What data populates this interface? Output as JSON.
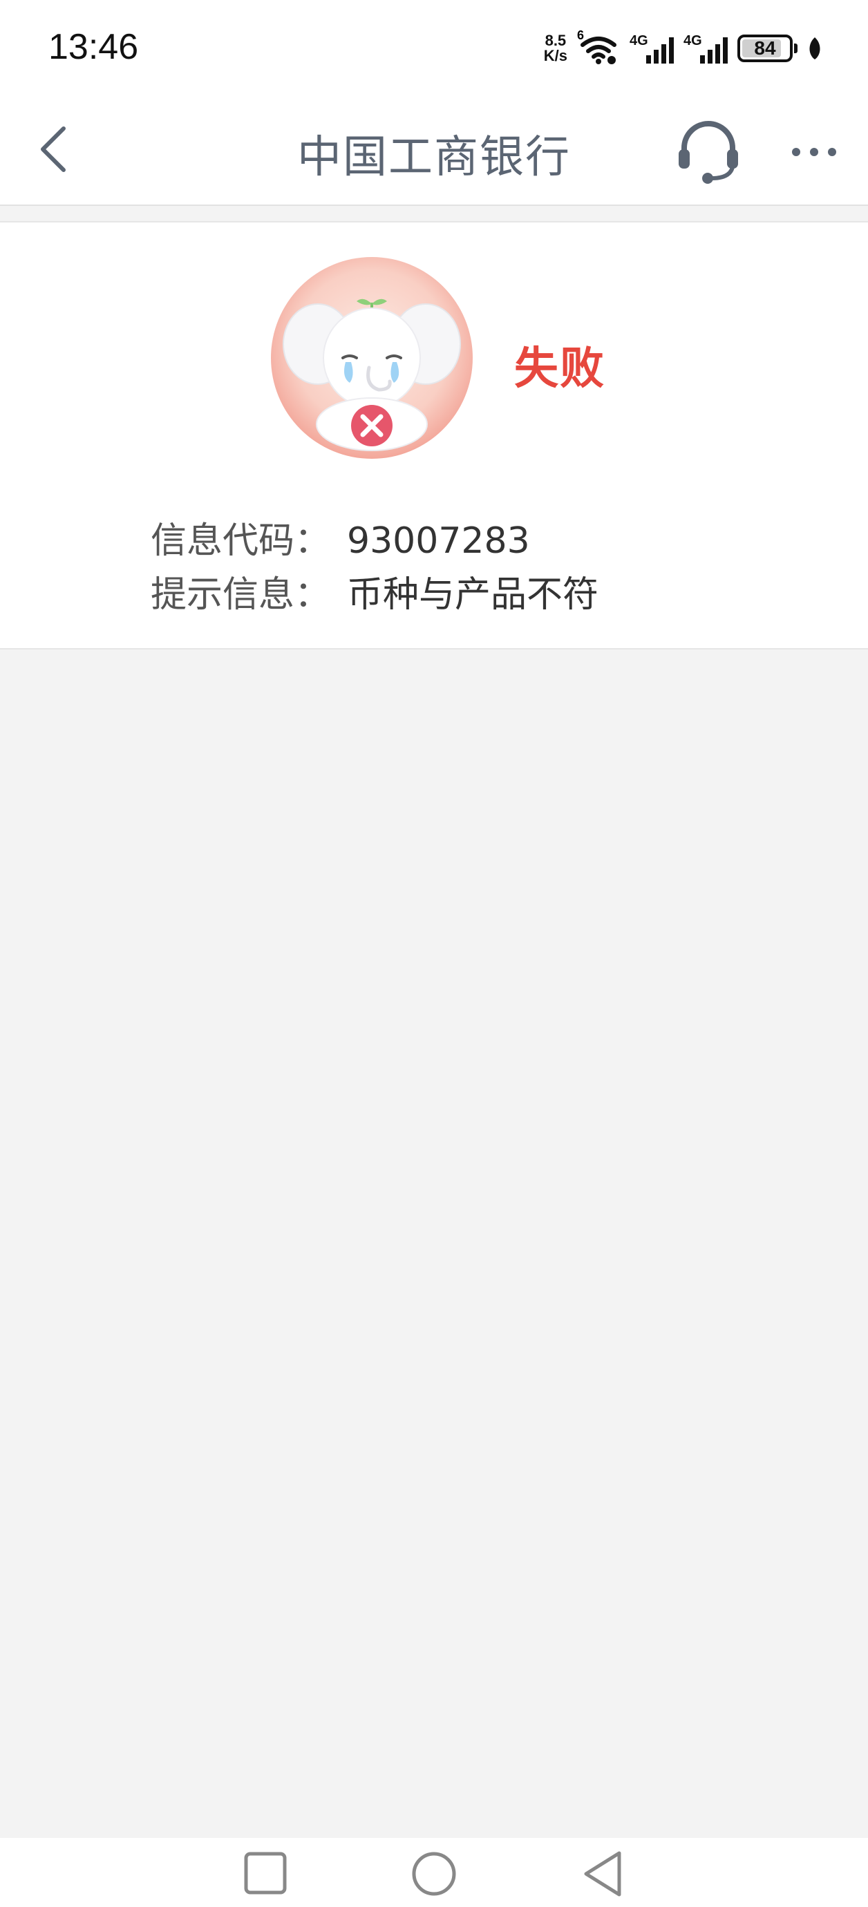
{
  "status_bar": {
    "time": "13:46",
    "net_speed_value": "8.5",
    "net_speed_unit": "K/s",
    "wifi_badge": "6",
    "signal1_label": "4G",
    "signal2_label": "4G",
    "battery_level": "84",
    "icons": [
      "wifi-icon",
      "signal-icon",
      "signal-icon",
      "battery-icon",
      "leaf-icon"
    ]
  },
  "header": {
    "title": "中国工商银行",
    "icons": [
      "chevron-left-icon",
      "headset-icon",
      "more-dots-icon"
    ]
  },
  "result": {
    "status": "失败",
    "status_color": "#e6473d",
    "mascot": "crying-elephant-error-icon",
    "rows": [
      {
        "label": "信息代码：",
        "value": "93007283"
      },
      {
        "label": "提示信息：",
        "value": "币种与产品不符"
      }
    ]
  },
  "nav_bar": {
    "icons": [
      "recent-apps-icon",
      "home-icon",
      "back-triangle-icon"
    ]
  }
}
